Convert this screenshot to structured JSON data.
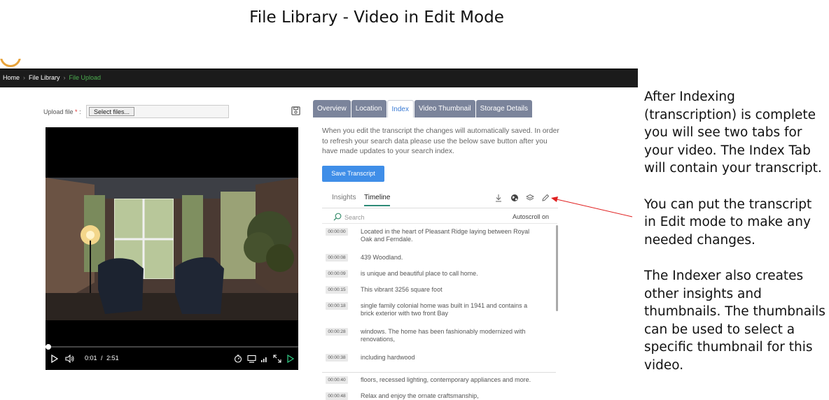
{
  "slide": {
    "title": "File Library - Video in Edit Mode"
  },
  "breadcrumb": {
    "items": [
      "Home",
      "File Library",
      "File Upload"
    ]
  },
  "upload": {
    "label": "Upload file",
    "required_mark": "*",
    "colon": ":",
    "button_label": "Select files..."
  },
  "video": {
    "current_time": "0:01",
    "separator": "/",
    "duration": "2:51",
    "progress": 0.006
  },
  "tabs": [
    {
      "label": "Overview"
    },
    {
      "label": "Location"
    },
    {
      "label": "Index",
      "active": true
    },
    {
      "label": "Video Thumbnail"
    },
    {
      "label": "Storage Details"
    }
  ],
  "index_panel": {
    "note": "When you edit the transcript the changes will automatically saved. In order to refresh your search data please use the below save button after you have made updates to your search index.",
    "save_button": "Save Transcript",
    "sub_tabs": [
      "Insights",
      "Timeline"
    ],
    "active_sub_tab": "Timeline",
    "search_placeholder": "Search",
    "autoscroll_label": "Autoscroll on",
    "icons": [
      "download-icon",
      "globe-icon",
      "layers-icon",
      "pencil-icon"
    ]
  },
  "transcript": [
    {
      "time": "00:00:00",
      "text": "Located in the heart of Pleasant Ridge laying between Royal Oak and Ferndale."
    },
    {
      "time": "00:00:08",
      "text": "439 Woodland."
    },
    {
      "time": "00:00:09",
      "text": "is unique and beautiful place to call home."
    },
    {
      "time": "00:00:15",
      "text": "This vibrant 3256 square foot"
    },
    {
      "time": "00:00:18",
      "text": "single family colonial home was built in 1941 and contains a brick exterior with two front Bay"
    },
    {
      "time": "00:00:28",
      "text": "windows. The home has been fashionably modernized with renovations,"
    },
    {
      "time": "00:00:38",
      "text": "including hardwood"
    },
    {
      "time": "00:00:40",
      "text": "floors, recessed lighting, contemporary appliances and more."
    },
    {
      "time": "00:00:48",
      "text": "Relax and enjoy the ornate craftsmanship,"
    }
  ],
  "side_notes": [
    "After Indexing (transcription) is complete you will see two tabs for your video.  The Index Tab will contain your transcript.",
    "You can put the transcript in Edit mode to make any needed changes.",
    "The Indexer also creates other insights and thumbnails.  The thumbnails can be used to select a specific thumbnail for this video."
  ],
  "colors": {
    "accent_blue": "#3f8ee8",
    "tab_gray": "#7b849b",
    "breadcrumb_active": "#4caf50",
    "timeline_underline": "#2e8b78",
    "annotation_arrow": "#e02020"
  }
}
